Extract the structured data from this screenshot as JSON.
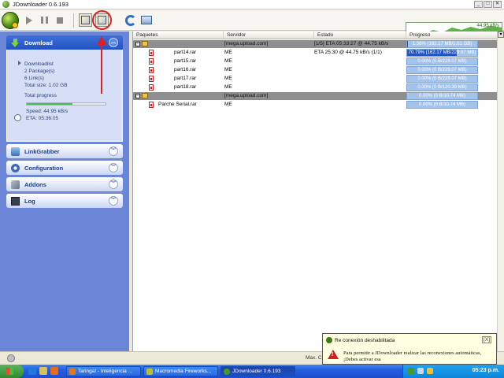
{
  "window": {
    "title": "JDownloader 0.6.193",
    "speed": "44.95 kB/s"
  },
  "titlebar_buttons": [
    "_",
    "□",
    "✕"
  ],
  "sidebar": {
    "download": {
      "label": "Download",
      "downloadlist": "Downloadlist",
      "packages": "2 Package(s)",
      "links": "6 Link(s)",
      "total_size": "Total size: 1.02 GB",
      "total_progress_label": "Total progress",
      "total_progress_fraction": 0.58,
      "speed": "Speed: 44.95 kB/s",
      "eta": "ETA: 05:36:05"
    },
    "panels": [
      {
        "label": "LinkGrabber",
        "icon": "linkgrabber-icon"
      },
      {
        "label": "Configuration",
        "icon": "configuration-icon"
      },
      {
        "label": "Addons",
        "icon": "addons-icon"
      },
      {
        "label": "Log",
        "icon": "log-icon"
      }
    ]
  },
  "table": {
    "columns": [
      "Paquetes",
      "Servidor",
      "Estado",
      "Progreso"
    ],
    "rows": [
      {
        "type": "package",
        "server": "[mega.upload.com]",
        "status": "[1/5] ETA 05:33:27 @ 44.75 kB/s",
        "progress": "1.56% (162.17 MB/1.01 GB)",
        "progress_fraction": 0.0156
      },
      {
        "type": "file",
        "name": "part14.rar",
        "server": "ME",
        "status": "ETA 25:30 @ 44.75 kB/s (1/1)",
        "progress": "70.79% (162.17 MB/229.07 MB)",
        "progress_fraction": 0.7079
      },
      {
        "type": "file",
        "name": "part15.rar",
        "server": "ME",
        "status": "",
        "progress": "0.00% (0 B/229.07 MB)",
        "progress_fraction": 0
      },
      {
        "type": "file",
        "name": "part16.rar",
        "server": "ME",
        "status": "",
        "progress": "0.00% (0 B/229.07 MB)",
        "progress_fraction": 0
      },
      {
        "type": "file",
        "name": "part17.rar",
        "server": "ME",
        "status": "",
        "progress": "0.00% (0 B/229.07 MB)",
        "progress_fraction": 0
      },
      {
        "type": "file",
        "name": "part18.rar",
        "server": "ME",
        "status": "",
        "progress": "0.00% (0 B/120.39 MB)",
        "progress_fraction": 0
      },
      {
        "type": "package",
        "server": "[mega.upload.com]",
        "status": "",
        "progress": "0.00% (0 B/10.74 MB)",
        "progress_fraction": 0
      },
      {
        "type": "file",
        "name": "Parche   Serial.rar",
        "server": "ME",
        "status": "",
        "progress": "0.00% (0 B/10.74 MB)",
        "progress_fraction": 0
      }
    ]
  },
  "statusbar": {
    "max_connections": "Max. C"
  },
  "notification": {
    "title": "Re conexión deshabilitada",
    "close": "[X]",
    "body": "Para permitir a JDownloader realizar las reconexiones automáticas, ¡Debes activar esa"
  },
  "taskbar": {
    "tasks": [
      {
        "label": "Taringa! - Inteligencia ...",
        "active": false
      },
      {
        "label": "Macromedia Fireworks...",
        "active": false
      },
      {
        "label": "JDownloader 0.6.193",
        "active": true
      }
    ],
    "clock": "05:23 p.m."
  },
  "colors": {
    "accent": "#2153c4",
    "progress_fill": "#2156c4",
    "annotation": "#e02020"
  }
}
